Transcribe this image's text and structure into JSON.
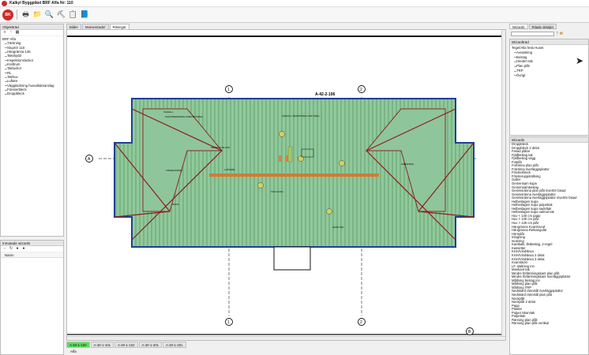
{
  "window_title": "Kalkyl Byggpläst BRF Alfa Nr: 110",
  "toolbar": {
    "logo_text": "BK"
  },
  "left_panel": {
    "title": "Objektträd",
    "root": "BRF Alfa",
    "items": [
      "Täckning",
      "Stuprör 110",
      "Hängränna 136",
      "Takskydd",
      "Inspektionsluckor",
      "Kraftrum",
      "Takluckor",
      "RL",
      "Takhuv",
      "Luftare",
      "Väggtäckning huvudtaksanslag",
      "Fönsterbleck",
      "Droppbleck"
    ]
  },
  "left_bottom": {
    "title": "Inmatade wizards",
    "column": "Namn"
  },
  "center_tabs": [
    "Bilder",
    "Momentrader",
    "Ritningar"
  ],
  "sheet_tabs": [
    "A-40-1-100",
    "A-40-1-101",
    "A-40-1-102",
    "A-40-1-201",
    "A-40-1-201"
  ],
  "status_text": "Alfa",
  "right_tabs": [
    "Wizards",
    "Ritade detaljer"
  ],
  "wizard_tree": {
    "title": "Wizardträd",
    "root": "Tegel/Alla hela Huset",
    "items": [
      "Avvattning",
      "Bostag",
      "Hindert tak",
      "Plan plåt",
      "TRP",
      "Övrigt"
    ]
  },
  "wizards_list": {
    "title": "Wizards",
    "items": [
      "Droppbleck",
      "Droppbleck 2 delat",
      "Fasad plåtar",
      "Fjällbeslag tak",
      "Fjällbeslag vägg",
      "Fotplåt",
      "Fotränna plan plåt",
      "Fotränna överläggsplattor",
      "Fönsterbleck",
      "Fönsteruppställning",
      "Galler",
      "Gemensam kupa",
      "Gemensambeslag",
      "Gesimsränna plan plåt invertör fasad",
      "Gesimsränna överläggsplattor",
      "Gesimsränna överläggsplattor invertör fasad",
      "Helbeslagen kupa",
      "Helbeslagen kupa pulpettak",
      "Helbeslagen kupa sadeltak",
      "Helbeslagen kupa valmat tak",
      "Huv < 130 cm papp",
      "Huv < 130 cm plåt",
      "Huv > 130 cm plåt",
      "Hängränna Kvartsrund",
      "Hängränna Rektangulär",
      "Hörnplåt",
      "Inlagning",
      "Isolering",
      "Kantbalk, liktbeslag, 2-regel",
      "Kassetter",
      "Krön/Vindskiva",
      "Krön/Vindskiva 2 delat",
      "Krön/Vindskiva 3 delat",
      "Kvarntäckt",
      "LF, stallning inn",
      "Mankant tak",
      "Mindre förläntningskant plan plåt",
      "Mindre förläntningskant överläggsplattor",
      "Mållning beslag inn",
      "Mållning plan plåt",
      "Mållning TRP",
      "Nedskärd rännstål överläggsplattor",
      "Nedskärd rännstål plan plåt",
      "Nockplåt",
      "Nockplåt 2 delat",
      "Papp",
      "Plastar",
      "Pulpet Skarvtak",
      "Pulpettak",
      "Ränning plan plåt",
      "Ränning plan plåt vertikal"
    ]
  },
  "drawing": {
    "sheet_ref": "A-42-2-106",
    "grid_labels": [
      "1",
      "2",
      "A",
      "B"
    ],
    "labels": [
      "TAKFALL",
      "TAKFÖRSÄKRING FÖRFÄKTNING",
      "TAKFALL TRAPPSTEG FÖR STEG",
      "SNÖRAS SKYDD",
      "LUFTARE",
      "TAKLUCKA",
      "NOCK",
      "VINKELRÄNNA",
      "HÅRDNING",
      "SKÅP TAK"
    ]
  }
}
